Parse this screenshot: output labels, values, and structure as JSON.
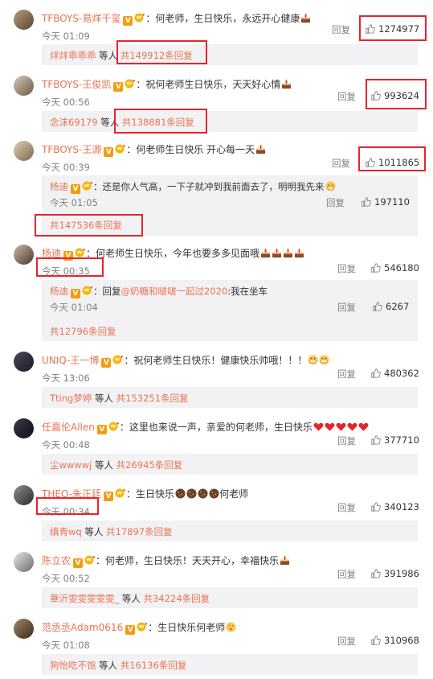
{
  "comments": [
    {
      "user": "TFBOYS-易烊千玺",
      "text": "：何老师，生日快乐，永远开心健康",
      "time": "今天 01:09",
      "reply": "回复",
      "likes": "1274977",
      "sub_user": "烊烊乖乖乖",
      "sub_mid": " 等人 ",
      "sub_count": "共149912条回复"
    },
    {
      "user": "TFBOYS-王俊凯",
      "text": "：祝何老师生日快乐，天天好心情",
      "time": "今天 00:56",
      "reply": "回复",
      "likes": "993624",
      "sub_user": "念沫69179",
      "sub_mid": " 等人 ",
      "sub_count": "共138881条回复"
    },
    {
      "user": "TFBOYS-王源",
      "text": "：何老师生日快乐  开心每一天",
      "time": "今天 00:39",
      "reply": "回复",
      "likes": "1011865",
      "nested_user": "杨迪",
      "nested_text": "：还是你人气高，一下子就冲到我前面去了，明明我先来",
      "nested_time": "今天 01:05",
      "nested_reply": "回复",
      "nested_likes": "197110",
      "more": "共147536条回复"
    },
    {
      "user": "杨迪",
      "text": "：何老师生日快乐，今年也要多多见面哦",
      "time": "今天 00:35",
      "reply": "回复",
      "likes": "546180",
      "nested_user": "杨迪",
      "nested_prefix": "：回复",
      "nested_at": "@奶糖和啵啵一起过2020",
      "nested_text": ":我在坐车",
      "nested_time": "今天 01:04",
      "nested_reply": "回复",
      "nested_likes": "6267",
      "more": "共12796条回复"
    },
    {
      "user": "UNIQ-王一博",
      "text": "：祝何老师生日快乐！健康快乐帅哦！！！",
      "time": "今天 13:06",
      "reply": "回复",
      "likes": "480362",
      "sub_user": "Tting梦婷",
      "sub_mid": " 等人 ",
      "sub_count": "共153251条回复"
    },
    {
      "user": "任嘉伦Allen",
      "text": "：这里也来说一声，亲爱的何老师，生日快乐",
      "time": "今天 00:48",
      "reply": "回复",
      "likes": "377710",
      "sub_user": "尘wwwwj",
      "sub_mid": " 等人 ",
      "sub_count": "共26945条回复"
    },
    {
      "user": "THEO-朱正廷",
      "text": "：生日快乐",
      "text2": "何老师",
      "time": "今天 00:34",
      "reply": "回复",
      "likes": "340123",
      "sub_user": "缜青wq",
      "sub_mid": " 等人 ",
      "sub_count": "共17897条回复"
    },
    {
      "user": "陈立农",
      "text": "：何老师，生日快乐！天天开心，幸福快乐",
      "time": "今天 00:52",
      "reply": "回复",
      "likes": "391986",
      "sub_user": "華沂雯雯雯雯雯_",
      "sub_mid": " 等人 ",
      "sub_count": "共34224条回复"
    },
    {
      "user": "范丞丞Adam0616",
      "text": "：生日快乐何老师",
      "time": "今天 01:08",
      "reply": "回复",
      "likes": "310968",
      "sub_user": "狗怡吃不饱",
      "sub_mid": " 等人 ",
      "sub_count": "共16136条回复"
    }
  ],
  "icons": {
    "verified": "verified-v-icon",
    "vip": "vip-crown-icon",
    "like": "thumb-up-icon"
  },
  "colors": {
    "accent": "#eb7350",
    "highlight": "#e8242b",
    "sub_bg": "#f2f2f5",
    "meta": "#808080"
  }
}
